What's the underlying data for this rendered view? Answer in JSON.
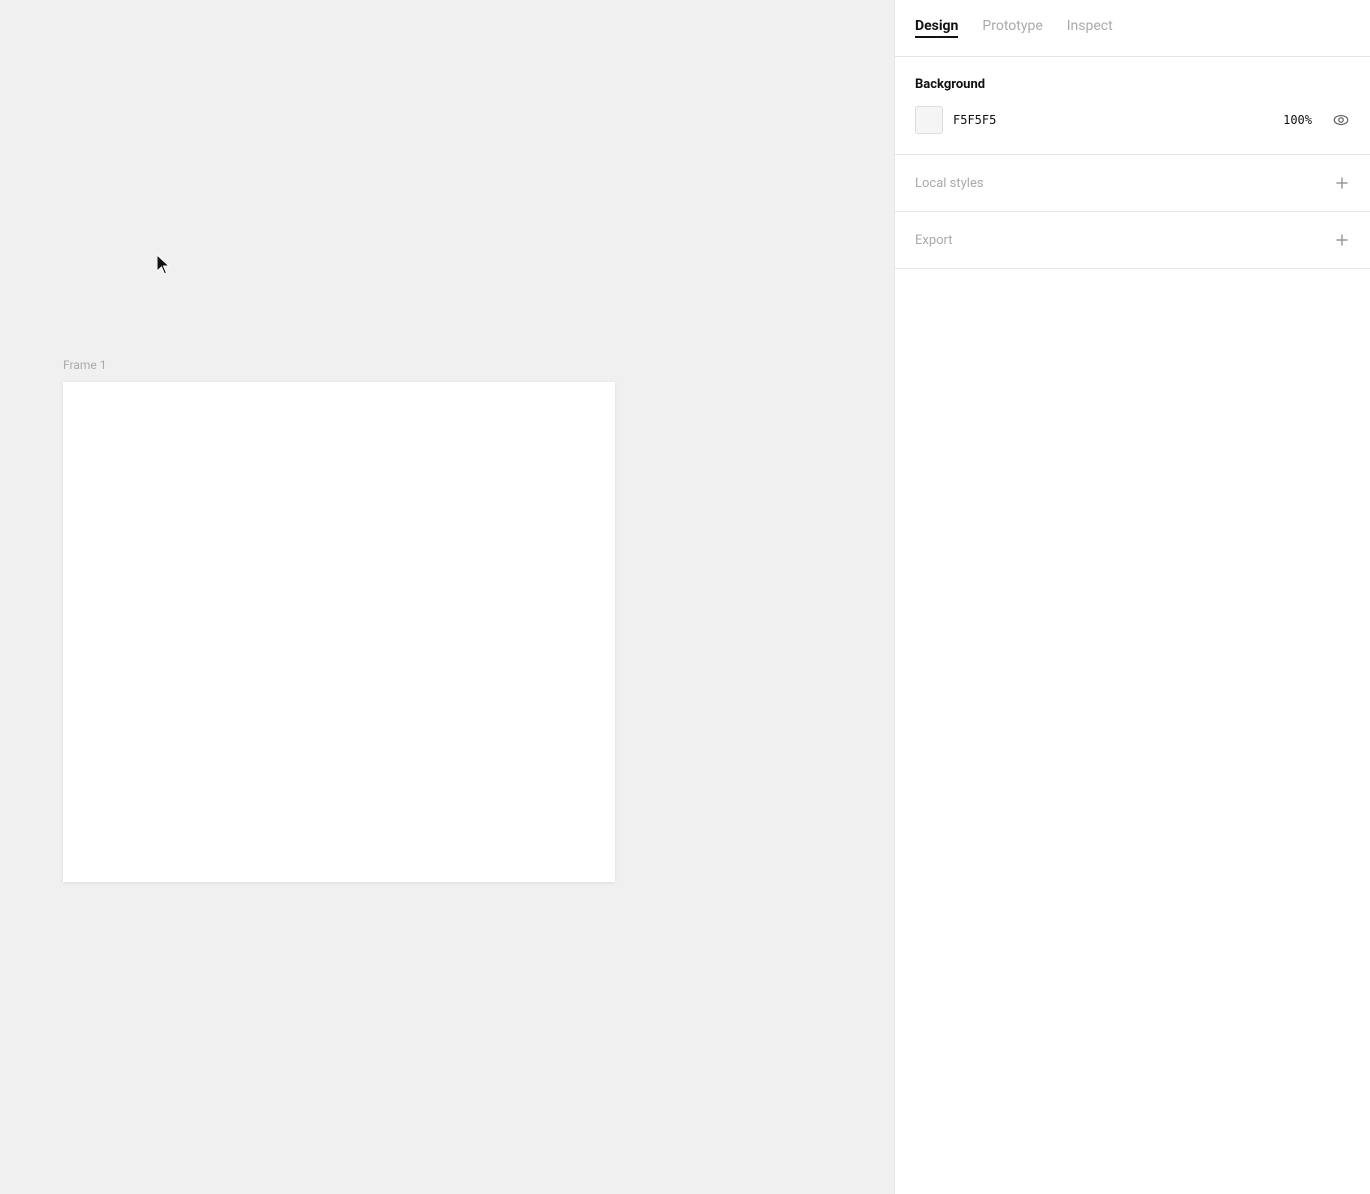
{
  "tabs": {
    "design": {
      "label": "Design",
      "active": true
    },
    "prototype": {
      "label": "Prototype",
      "active": false
    },
    "inspect": {
      "label": "Inspect",
      "active": false
    }
  },
  "background": {
    "section_title": "Background",
    "color_hex": "F5F5F5",
    "opacity": "100%",
    "swatch_color": "#F5F5F5"
  },
  "local_styles": {
    "section_title": "Local styles"
  },
  "export": {
    "section_title": "Export"
  },
  "canvas": {
    "frame_label": "Frame 1",
    "background_color": "#f0f0f0"
  }
}
